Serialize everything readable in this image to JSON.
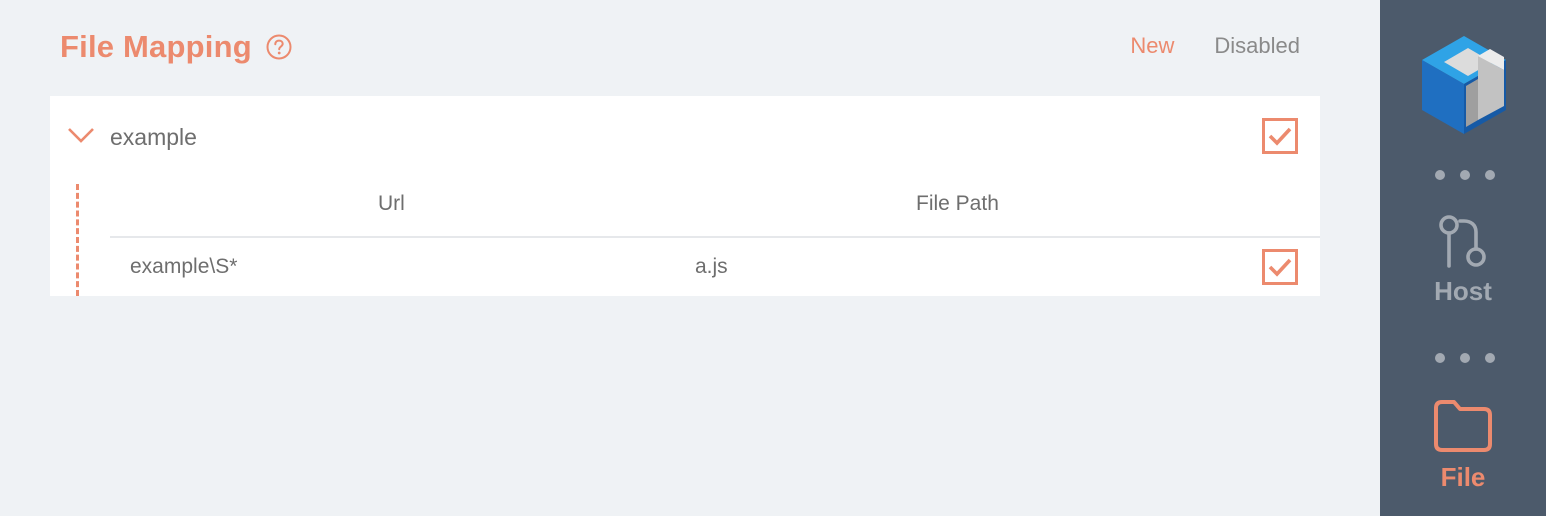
{
  "page": {
    "title": "File Mapping",
    "help_icon": "help-circle-icon",
    "actions": {
      "new_label": "New",
      "disabled_label": "Disabled"
    }
  },
  "group": {
    "name": "example",
    "expanded": true,
    "enabled": true,
    "columns": {
      "url": "Url",
      "file_path": "File Path"
    },
    "rows": [
      {
        "url": "example\\S*",
        "file_path": "a.js",
        "enabled": true
      }
    ]
  },
  "sidebar": {
    "items": [
      {
        "label": "Host",
        "icon": "git-compare-icon",
        "active": false
      },
      {
        "label": "File",
        "icon": "folder-icon",
        "active": true
      }
    ]
  },
  "colors": {
    "accent": "#ec8a6e",
    "sidebar_bg": "#4c5a6b",
    "inactive_text": "#a2a9b2",
    "page_bg": "#eff2f5"
  }
}
